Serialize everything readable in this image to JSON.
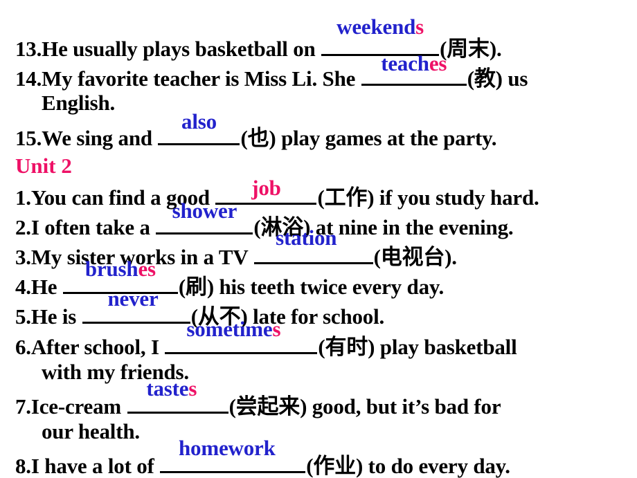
{
  "slide": {
    "background_color": "#ffffff",
    "text_color": "#000000",
    "answer_stem_color": "#2222cc",
    "answer_suffix_color": "#ee1166",
    "heading_color": "#ee1166"
  },
  "items": [
    {
      "number": "13.",
      "before": "He usually  plays basketball on ",
      "answer_stem": "weekend",
      "answer_suffix": "s",
      "after": "(周末).",
      "continuation": null
    },
    {
      "number": "14.",
      "before": "My favorite teacher is Miss Li. She ",
      "answer_stem": "teach",
      "answer_suffix": "es",
      "after": "(教) us",
      "continuation": "English."
    },
    {
      "number": "15.",
      "before": "We sing and ",
      "answer_stem": "also",
      "answer_suffix": "",
      "after": "(也) play games at the party.",
      "continuation": null
    }
  ],
  "unit_heading": "Unit 2",
  "unit2_items": [
    {
      "number": "1.",
      "before": "You can find a good ",
      "answer_stem": "",
      "answer_suffix": "job",
      "after": "(工作) if you study hard.",
      "continuation": null
    },
    {
      "number": "2.",
      "before": "I often take a ",
      "answer_stem": "shower",
      "answer_suffix": "",
      "after": "(淋浴) at nine in the evening.",
      "continuation": null
    },
    {
      "number": "3.",
      "before": "My sister works in a TV ",
      "answer_stem": "station",
      "answer_suffix": "",
      "after": "(电视台).",
      "continuation": null
    },
    {
      "number": "4.",
      "before": "He ",
      "answer_stem": "brush",
      "answer_suffix": "es",
      "after": "(刷) his teeth twice every day.",
      "continuation": null
    },
    {
      "number": "5.",
      "before": "He is ",
      "answer_stem": "never",
      "answer_suffix": "",
      "after": "(从不) late for school.",
      "continuation": null
    },
    {
      "number": "6.",
      "before": "After school, I ",
      "answer_stem": "sometime",
      "answer_suffix": "s",
      "after": "(有时) play basketball",
      "continuation": "with my friends."
    },
    {
      "number": "7.",
      "before": "Ice-cream ",
      "answer_stem": "taste",
      "answer_suffix": "s",
      "after": "(尝起来) good, but it’s bad for",
      "continuation": "our health."
    },
    {
      "number": "8.",
      "before": "I have a lot of ",
      "answer_stem": "homework",
      "answer_suffix": "",
      "after": "(作业) to do every day.",
      "continuation": null
    }
  ]
}
